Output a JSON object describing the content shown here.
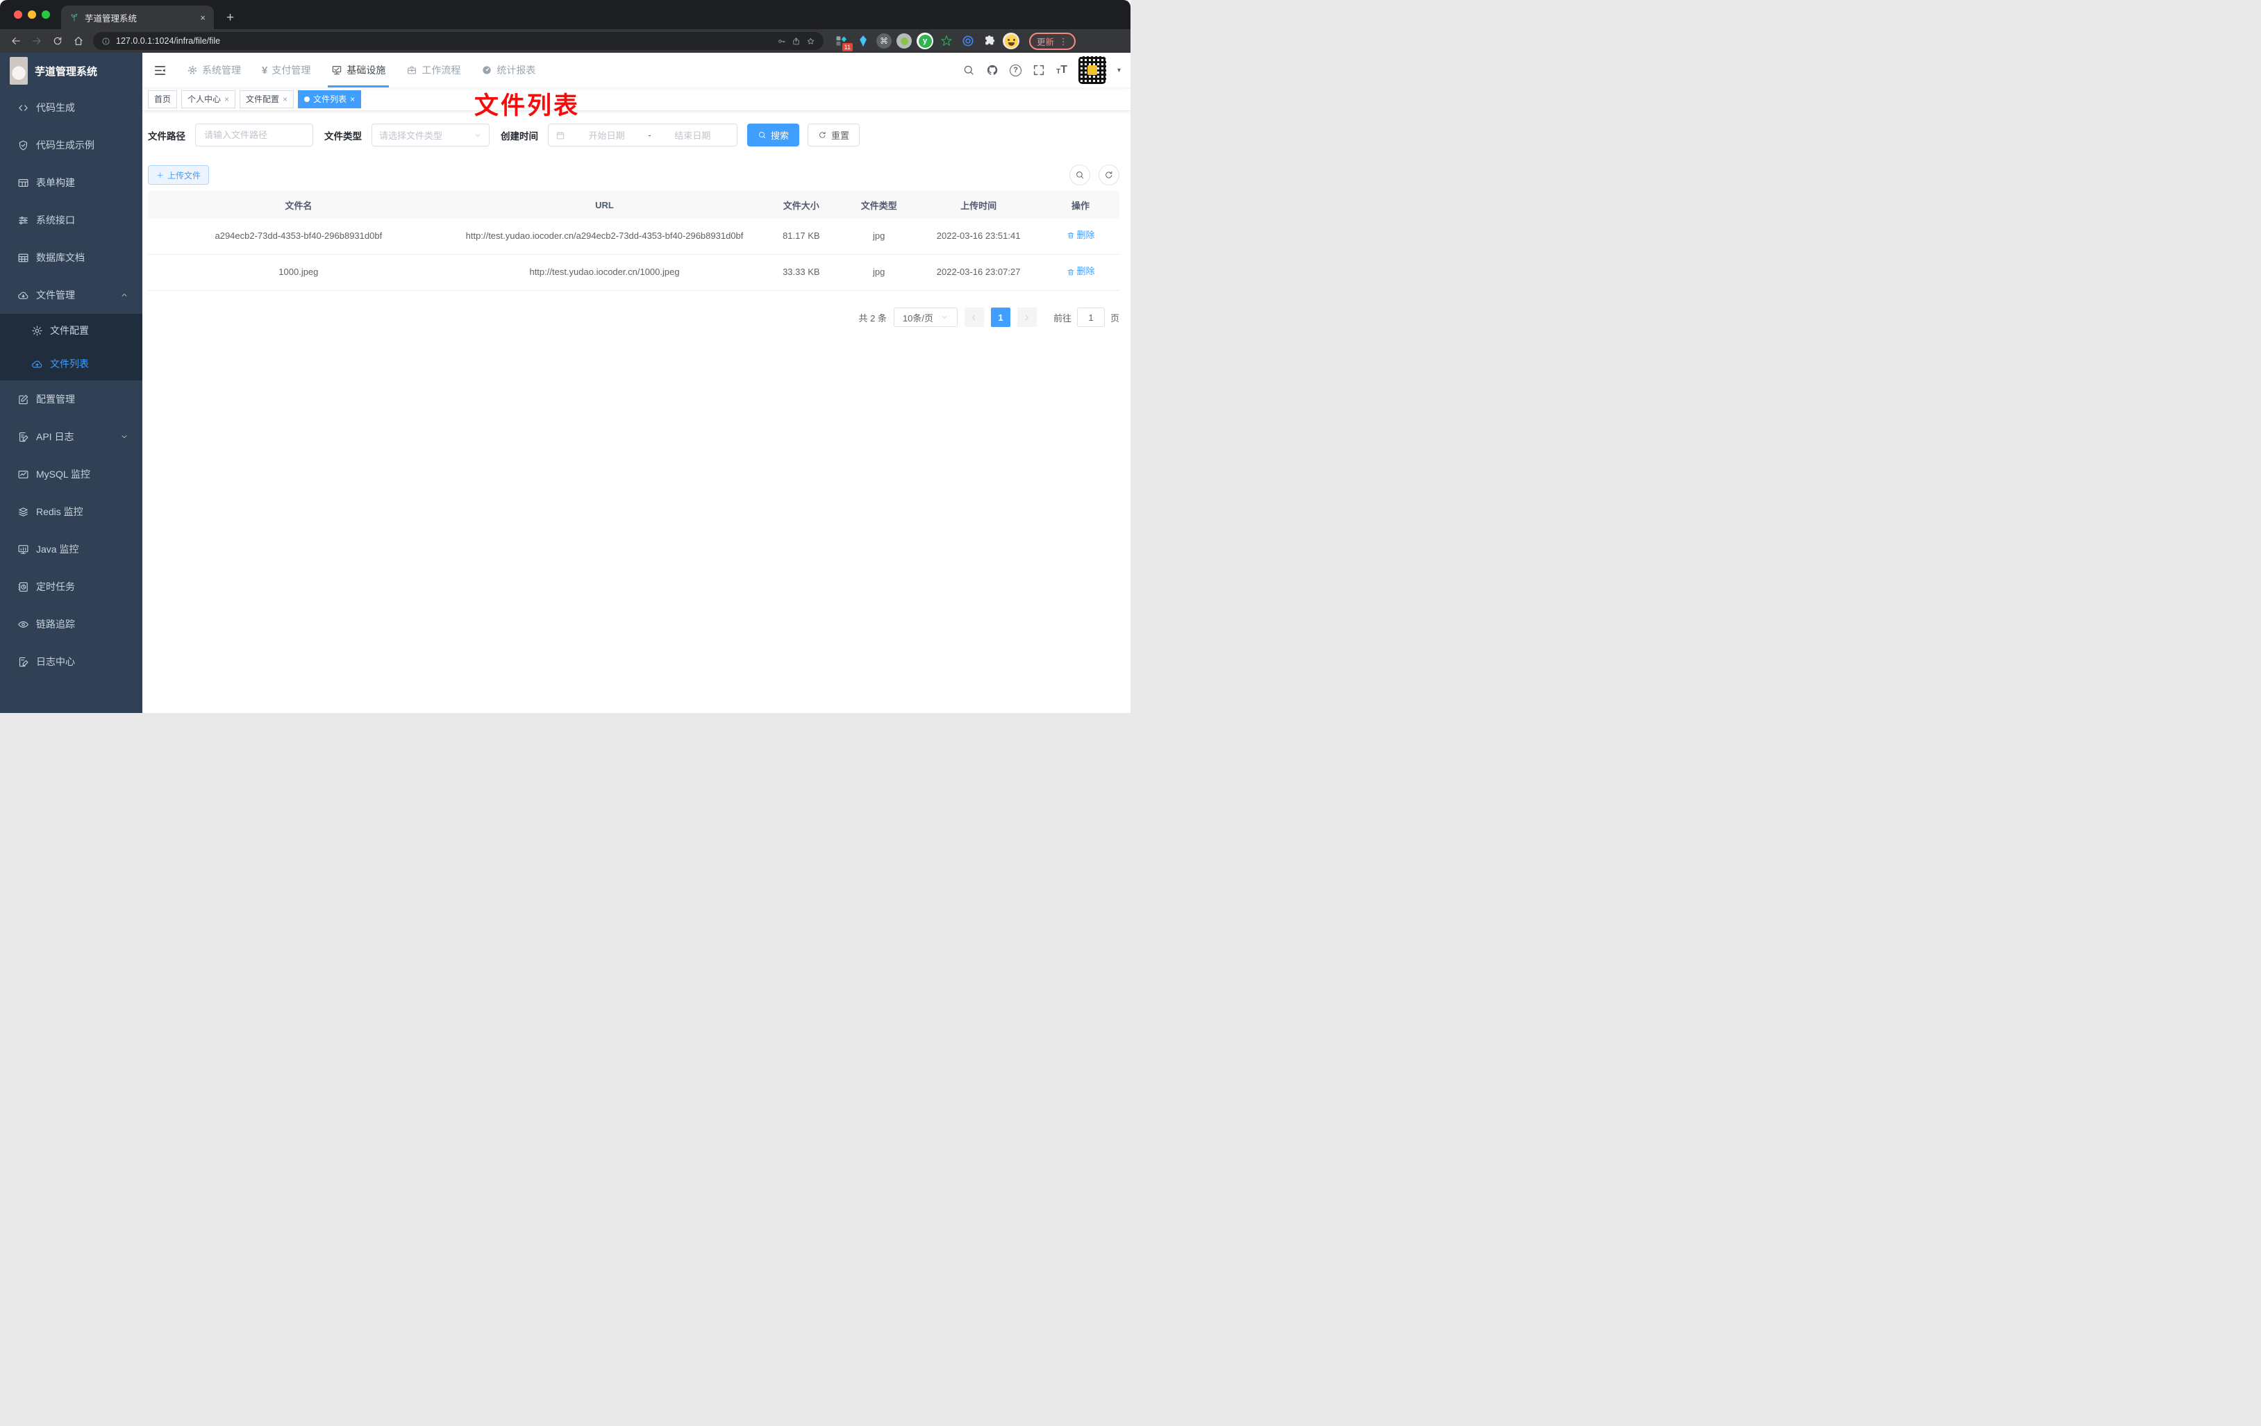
{
  "browser": {
    "tab": {
      "title": "芋道管理系统",
      "favicon": "sprout-icon"
    },
    "url": "127.0.0.1:1024/infra/file/file",
    "extensions_badge": "11",
    "update_label": "更新"
  },
  "icon_glyphs": {
    "tab_close": "×",
    "new_tab": "+",
    "cmd": "⌘",
    "ext_y": "y",
    "menu_dots": "⋮",
    "yen": "¥",
    "help": "?",
    "font_small": "T",
    "font_large": "T",
    "caret_down": "▾",
    "chip_close": "×"
  },
  "app": {
    "logo_title": "芋道管理系统",
    "top_nav": {
      "items": [
        {
          "label": "系统管理",
          "icon": "gear-icon",
          "active": false
        },
        {
          "label": "支付管理",
          "icon": "yen-icon",
          "active": false
        },
        {
          "label": "基础设施",
          "icon": "infra-monitor-icon",
          "active": true
        },
        {
          "label": "工作流程",
          "icon": "briefcase-icon",
          "active": false
        },
        {
          "label": "统计报表",
          "icon": "dashboard-icon",
          "active": false
        }
      ]
    },
    "tags": {
      "items": [
        {
          "label": "首页",
          "closable": false,
          "active": false
        },
        {
          "label": "个人中心",
          "closable": true,
          "active": false
        },
        {
          "label": "文件配置",
          "closable": true,
          "active": false
        },
        {
          "label": "文件列表",
          "closable": true,
          "active": true
        }
      ]
    },
    "annotation": "文件列表",
    "sidebar": {
      "items": [
        {
          "label": "代码生成",
          "icon": "code-icon"
        },
        {
          "label": "代码生成示例",
          "icon": "shield-check-icon"
        },
        {
          "label": "表单构建",
          "icon": "form-grid-icon"
        },
        {
          "label": "系统接口",
          "icon": "sliders-icon"
        },
        {
          "label": "数据库文档",
          "icon": "database-table-icon"
        },
        {
          "label": "文件管理",
          "icon": "cloud-download-icon",
          "expanded": true,
          "children": [
            {
              "label": "文件配置",
              "icon": "gear-icon",
              "active": false
            },
            {
              "label": "文件列表",
              "icon": "cloud-upload-icon",
              "active": true
            }
          ]
        },
        {
          "label": "配置管理",
          "icon": "edit-square-icon"
        },
        {
          "label": "API 日志",
          "icon": "log-edit-icon",
          "collapsed": true
        },
        {
          "label": "MySQL 监控",
          "icon": "chart-monitor-icon"
        },
        {
          "label": "Redis 监控",
          "icon": "layers-icon"
        },
        {
          "label": "Java 监控",
          "icon": "java-monitor-icon"
        },
        {
          "label": "定时任务",
          "icon": "schedule-icon"
        },
        {
          "label": "链路追踪",
          "icon": "eye-icon"
        },
        {
          "label": "日志中心",
          "icon": "log-center-icon"
        }
      ]
    },
    "filters": {
      "path_label": "文件路径",
      "path_placeholder": "请输入文件路径",
      "type_label": "文件类型",
      "type_placeholder": "请选择文件类型",
      "time_label": "创建时间",
      "start_placeholder": "开始日期",
      "separator": "-",
      "end_placeholder": "结束日期",
      "search_label": "搜索",
      "reset_label": "重置"
    },
    "toolbar": {
      "upload_label": "上传文件"
    },
    "table": {
      "columns": [
        "文件名",
        "URL",
        "文件大小",
        "文件类型",
        "上传时间",
        "操作"
      ],
      "rows": [
        {
          "name": "a294ecb2-73dd-4353-bf40-296b8931d0bf",
          "url": "http://test.yudao.iocoder.cn/a294ecb2-73dd-4353-bf40-296b8931d0bf",
          "size": "81.17 KB",
          "type": "jpg",
          "time": "2022-03-16 23:51:41",
          "action": "删除"
        },
        {
          "name": "1000.jpeg",
          "url": "http://test.yudao.iocoder.cn/1000.jpeg",
          "size": "33.33 KB",
          "type": "jpg",
          "time": "2022-03-16 23:07:27",
          "action": "删除"
        }
      ]
    },
    "pagination": {
      "total": "共 2 条",
      "page_size": "10条/页",
      "current_page": "1",
      "goto_label": "前往",
      "goto_value": "1",
      "page_unit": "页"
    },
    "colors": {
      "accent": "#409eff",
      "sidebar_bg": "#304156",
      "submenu_bg": "#1f2d3d",
      "annotation_red": "#f40c0c"
    }
  }
}
